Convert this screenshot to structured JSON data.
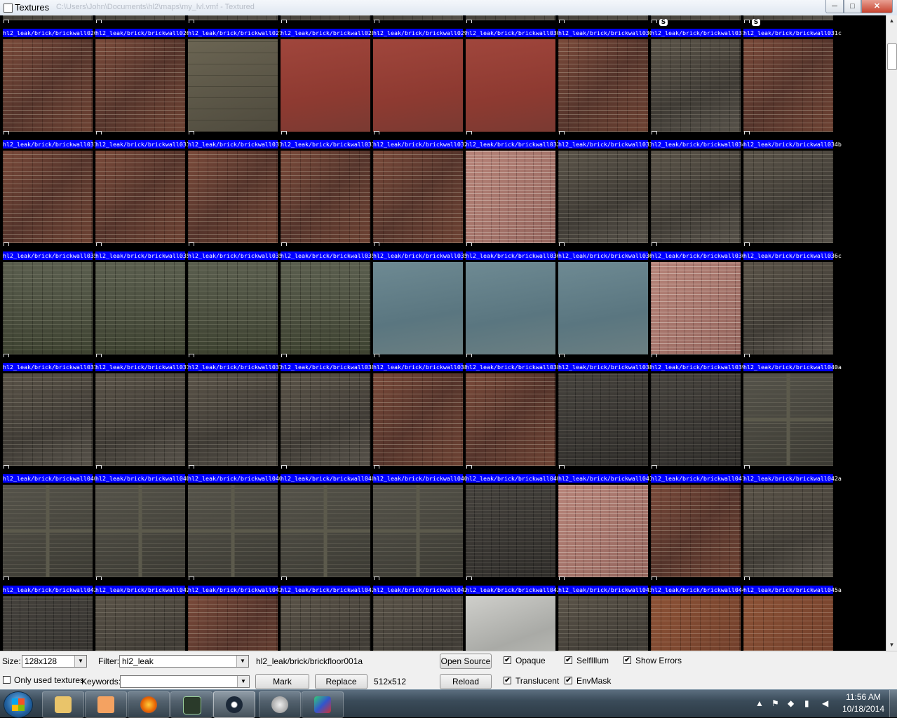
{
  "window": {
    "title": "Textures",
    "path": "C:\\Users\\John\\Documents\\hl2\\maps\\my_lvl.vmf - Textured",
    "min_glyph": "─",
    "max_glyph": "□",
    "close_glyph": "✕"
  },
  "grid": {
    "top_partial_badges": [
      "",
      "",
      "",
      "",
      "",
      "",
      "",
      "S",
      "S"
    ],
    "rows": [
      {
        "names": [
          "hl2_leak/brick/brickwall026",
          "hl2_leak/brick/brickwall026",
          "hl2_leak/brick/brickwall027",
          "hl2_leak/brick/brickwall028",
          "hl2_leak/brick/brickwall029",
          "hl2_leak/brick/brickwall030",
          "hl2_leak/brick/brickwall030",
          "hl2_leak/brick/brickwall031",
          "hl2_leak/brick/brickwall031c"
        ],
        "badges": [
          "",
          "",
          "",
          "",
          "",
          "",
          "",
          "",
          ""
        ],
        "textures": [
          "brick",
          "brick",
          "stone",
          "redplaster",
          "redplaster",
          "redplaster",
          "brick",
          "brickgray",
          "brick"
        ]
      },
      {
        "names": [
          "hl2_leak/brick/brickwall031",
          "hl2_leak/brick/brickwall031",
          "hl2_leak/brick/brickwall031",
          "hl2_leak/brick/brickwall031",
          "hl2_leak/brick/brickwall032",
          "hl2_leak/brick/brickwall032",
          "hl2_leak/brick/brickwall033",
          "hl2_leak/brick/brickwall034",
          "hl2_leak/brick/brickwall034b"
        ],
        "badges": [
          "",
          "",
          "",
          "",
          "",
          "",
          "",
          "",
          ""
        ],
        "textures": [
          "brick",
          "brick",
          "brick",
          "brick",
          "brick",
          "brickpink",
          "brickgray",
          "brickgray",
          "brickgray"
        ]
      },
      {
        "names": [
          "hl2_leak/brick/brickwall035",
          "hl2_leak/brick/brickwall035",
          "hl2_leak/brick/brickwall035",
          "hl2_leak/brick/brickwall035",
          "hl2_leak/brick/brickwall035",
          "hl2_leak/brick/brickwall036",
          "hl2_leak/brick/brickwall036",
          "hl2_leak/brick/brickwall036",
          "hl2_leak/brick/brickwall036c"
        ],
        "badges": [
          "",
          "",
          "",
          "",
          "",
          "",
          "",
          "",
          ""
        ],
        "textures": [
          "greenbrick",
          "greenbrick",
          "greenbrick",
          "greenbrick",
          "blue",
          "blue",
          "blue",
          "brickpink",
          "brickgray"
        ]
      },
      {
        "names": [
          "hl2_leak/brick/brickwall037",
          "hl2_leak/brick/brickwall037",
          "hl2_leak/brick/brickwall037",
          "hl2_leak/brick/brickwall038",
          "hl2_leak/brick/brickwall038",
          "hl2_leak/brick/brickwall038",
          "hl2_leak/brick/brickwall038",
          "hl2_leak/brick/brickwall039",
          "hl2_leak/brick/brickwall040a"
        ],
        "badges": [
          "",
          "",
          "",
          "",
          "",
          "",
          "",
          "",
          ""
        ],
        "textures": [
          "brickgray",
          "brickgray",
          "brickgray",
          "brickgray",
          "brick",
          "brick",
          "brickdark",
          "brickdark",
          "timber"
        ]
      },
      {
        "names": [
          "hl2_leak/brick/brickwall040",
          "hl2_leak/brick/brickwall040",
          "hl2_leak/brick/brickwall040",
          "hl2_leak/brick/brickwall040",
          "hl2_leak/brick/brickwall040",
          "hl2_leak/brick/brickwall040",
          "hl2_leak/brick/brickwall041",
          "hl2_leak/brick/brickwall041",
          "hl2_leak/brick/brickwall042a"
        ],
        "badges": [
          "",
          "",
          "",
          "",
          "",
          "",
          "",
          "",
          ""
        ],
        "textures": [
          "timber",
          "timber",
          "timber",
          "timber",
          "timber",
          "brickdark",
          "brickpink",
          "brick",
          "brickgray"
        ]
      },
      {
        "names": [
          "hl2_leak/brick/brickwall042",
          "hl2_leak/brick/brickwall042",
          "hl2_leak/brick/brickwall042",
          "hl2_leak/brick/brickwall042",
          "hl2_leak/brick/brickwall042",
          "hl2_leak/brick/brickwall042",
          "hl2_leak/brick/brickwall043",
          "hl2_leak/brick/brickwall044",
          "hl2_leak/brick/brickwall045a"
        ],
        "badges": [
          "",
          "",
          "",
          "",
          "",
          "",
          "",
          "",
          ""
        ],
        "textures": [
          "brickdark",
          "brickgray",
          "brick",
          "brickgray",
          "brickgray",
          "concrete",
          "brickgray",
          "brickorange",
          "brickorange"
        ]
      }
    ]
  },
  "panel": {
    "size_label": "Size:",
    "size_value": "128x128",
    "filter_label": "Filter:",
    "filter_value": "hl2_leak",
    "selected_texture": "hl2_leak/brick/brickfloor001a",
    "open_source": "Open Source",
    "opaque": "Opaque",
    "selfillum": "SelfIllum",
    "show_errors": "Show Errors",
    "only_used": "Only used textures",
    "keywords_label": "Keywords:",
    "keywords_value": "",
    "mark": "Mark",
    "replace": "Replace",
    "dimensions": "512x512",
    "reload": "Reload",
    "translucent": "Translucent",
    "envmask": "EnvMask",
    "check_glyph": "✔",
    "opaque_checked": true,
    "selfillum_checked": true,
    "show_errors_checked": true,
    "only_used_checked": false,
    "translucent_checked": true,
    "envmask_checked": true
  },
  "taskbar": {
    "apps": [
      "explorer-icon",
      "media-player-icon",
      "firefox-icon",
      "hammer-icon",
      "steam-icon",
      "speaker-app-icon",
      "tool-icon"
    ],
    "active_app": "steam-icon",
    "time": "11:56 AM",
    "date": "10/18/2014",
    "colors": {
      "firefox": "#e66000",
      "steam": "#1b2838",
      "explorer": "#e9c46a",
      "media": "#f4a261"
    }
  }
}
